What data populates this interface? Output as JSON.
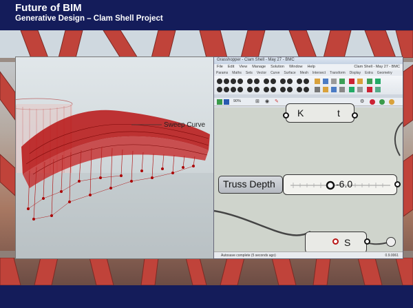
{
  "slide": {
    "title": "Future of BIM",
    "subtitle": "Generative Design – Clam Shell Project"
  },
  "render": {
    "label": "Sweep Curve"
  },
  "grasshopper": {
    "window_title": "Grasshopper - Clam Shell - May 27 - BMC",
    "menu": [
      "File",
      "Edit",
      "View",
      "Manage",
      "Solution",
      "Window",
      "Help"
    ],
    "menu_right": "Clam Shell - May 27 - BMC",
    "tabs": [
      "Params",
      "Maths",
      "Sets",
      "Vector",
      "Curve",
      "Surface",
      "Mesh",
      "Intersect",
      "Transform",
      "Display",
      "Extra",
      "Geometry"
    ],
    "zoom": "90%",
    "components": {
      "k_left": "K",
      "k_right": "t",
      "slider_label": "Truss Depth",
      "slider_value": "-6.0",
      "s_label": "S"
    },
    "status": "Autosave complete (5 seconds ago)",
    "version": "0.9.0061"
  },
  "colors": {
    "title_bg": "#141c5a",
    "truss_red": "#b81414"
  }
}
